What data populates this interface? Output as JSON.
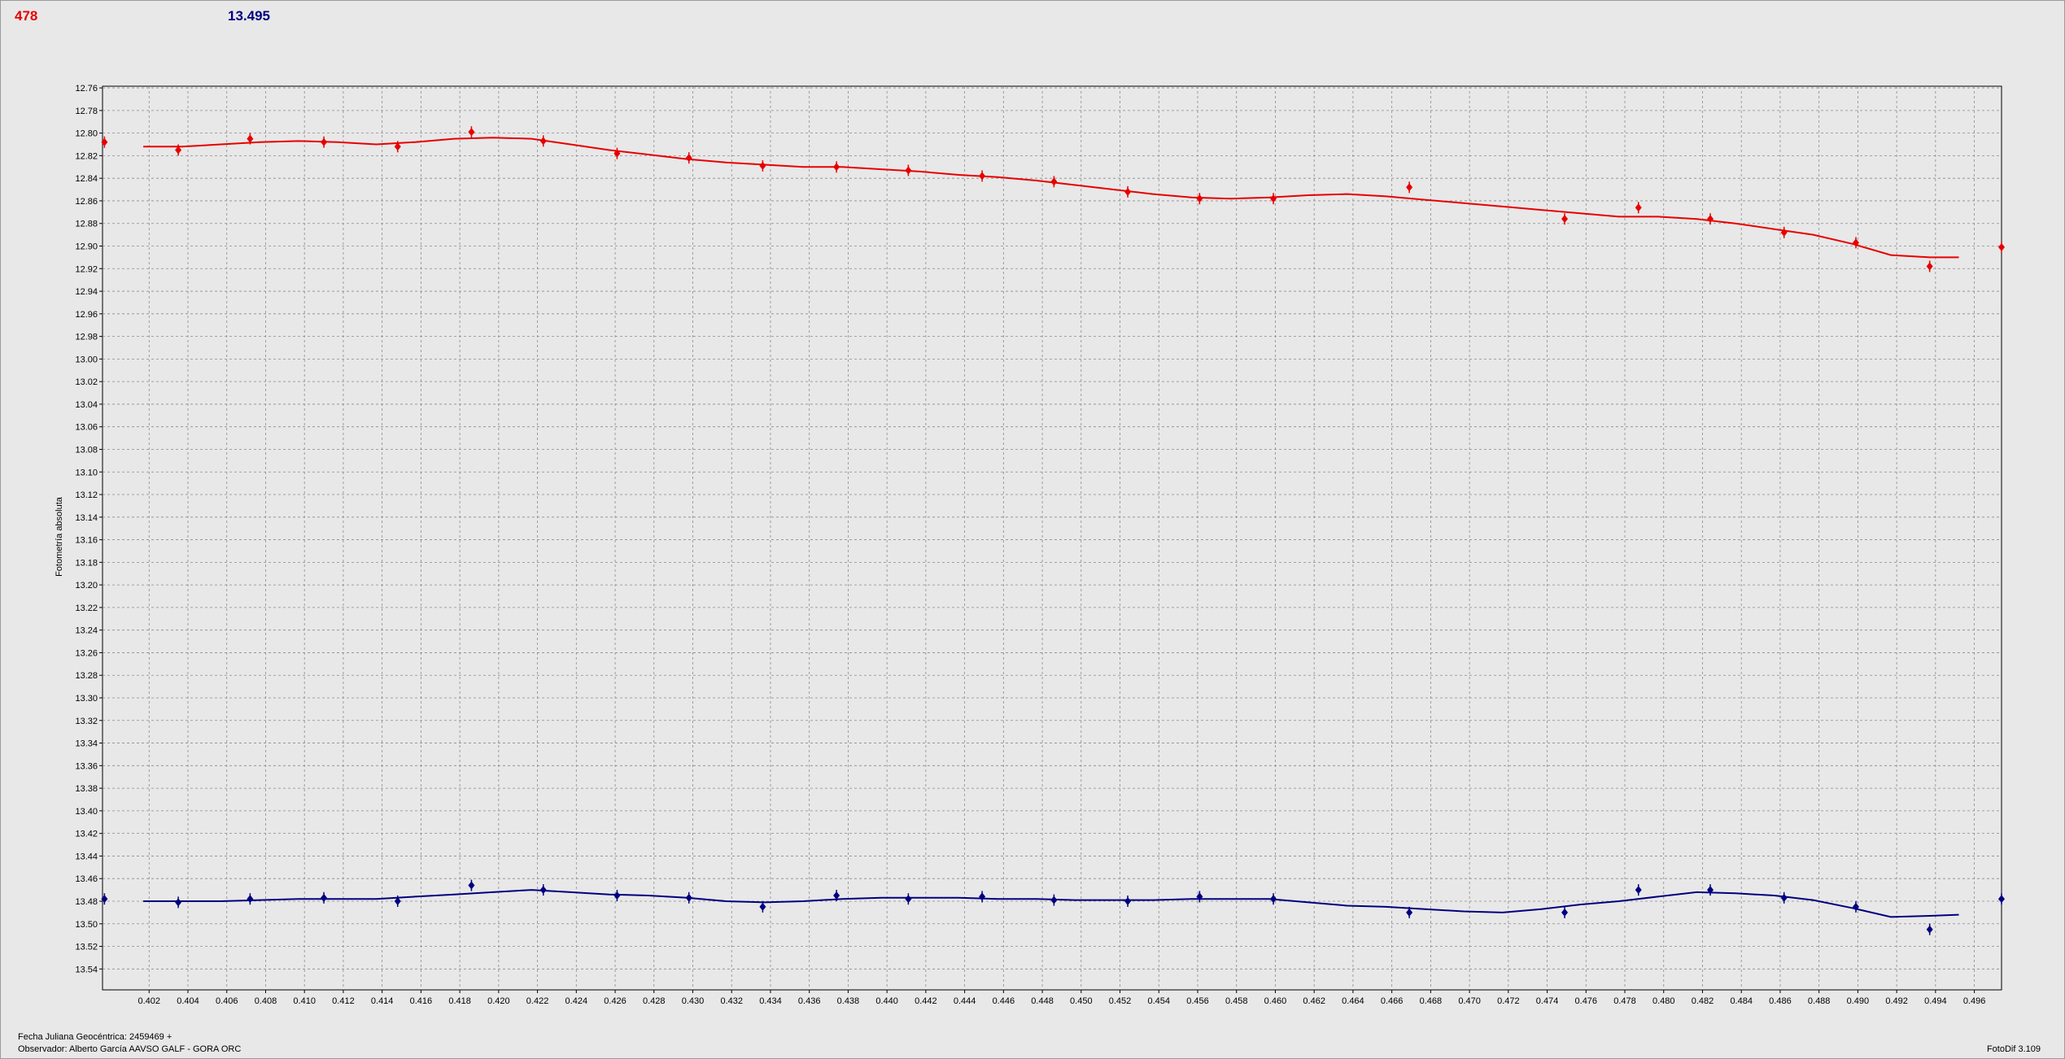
{
  "header": {
    "left_value": "478",
    "right_value": "13.495"
  },
  "footer": {
    "line1": "Fecha Juliana Geocéntrica: 2459469 +",
    "line2": "Observador: Alberto García AAVSO GALF - GORA ORC",
    "version": "FotoDif 3.109"
  },
  "colors": {
    "series_red": "#e80000",
    "series_blue": "#000080",
    "grid": "#8a8a8a",
    "plot_bg": "#e8e8e8"
  },
  "chart_data": {
    "type": "scatter",
    "title": "",
    "xlabel": "",
    "ylabel": "Fotometría absoluta",
    "xlim": [
      0.3996,
      0.4974
    ],
    "ylim": [
      12.7585,
      13.5585
    ],
    "y_inverted": true,
    "grid": true,
    "legend": "none",
    "x_ticks": [
      "0.402",
      "0.404",
      "0.406",
      "0.408",
      "0.410",
      "0.412",
      "0.414",
      "0.416",
      "0.418",
      "0.420",
      "0.422",
      "0.424",
      "0.426",
      "0.428",
      "0.430",
      "0.432",
      "0.434",
      "0.436",
      "0.438",
      "0.440",
      "0.442",
      "0.444",
      "0.446",
      "0.448",
      "0.450",
      "0.452",
      "0.454",
      "0.456",
      "0.458",
      "0.460",
      "0.462",
      "0.464",
      "0.466",
      "0.468",
      "0.470",
      "0.472",
      "0.474",
      "0.476",
      "0.478",
      "0.480",
      "0.482",
      "0.484",
      "0.486",
      "0.488",
      "0.490",
      "0.492",
      "0.494",
      "0.496"
    ],
    "y_ticks": [
      "12.76",
      "12.78",
      "12.80",
      "12.82",
      "12.84",
      "12.86",
      "12.88",
      "12.90",
      "12.92",
      "12.94",
      "12.96",
      "12.98",
      "13.00",
      "13.02",
      "13.04",
      "13.06",
      "13.08",
      "13.10",
      "13.12",
      "13.14",
      "13.16",
      "13.18",
      "13.20",
      "13.22",
      "13.24",
      "13.26",
      "13.28",
      "13.30",
      "13.32",
      "13.34",
      "13.36",
      "13.38",
      "13.40",
      "13.42",
      "13.44",
      "13.46",
      "13.48",
      "13.50",
      "13.52",
      "13.54"
    ],
    "series": [
      {
        "color": "#e80000",
        "points": [
          {
            "x": 0.3997,
            "y": 12.808
          },
          {
            "x": 0.4035,
            "y": 12.815
          },
          {
            "x": 0.4072,
            "y": 12.805
          },
          {
            "x": 0.411,
            "y": 12.808
          },
          {
            "x": 0.4148,
            "y": 12.812
          },
          {
            "x": 0.4186,
            "y": 12.799
          },
          {
            "x": 0.4223,
            "y": 12.807
          },
          {
            "x": 0.4261,
            "y": 12.818
          },
          {
            "x": 0.4298,
            "y": 12.822
          },
          {
            "x": 0.4336,
            "y": 12.829
          },
          {
            "x": 0.4374,
            "y": 12.83
          },
          {
            "x": 0.4411,
            "y": 12.833
          },
          {
            "x": 0.4449,
            "y": 12.838
          },
          {
            "x": 0.4486,
            "y": 12.843
          },
          {
            "x": 0.4524,
            "y": 12.852
          },
          {
            "x": 0.4561,
            "y": 12.858
          },
          {
            "x": 0.4599,
            "y": 12.858
          },
          {
            "x": 0.4669,
            "y": 12.848
          },
          {
            "x": 0.4749,
            "y": 12.876
          },
          {
            "x": 0.4787,
            "y": 12.866
          },
          {
            "x": 0.4824,
            "y": 12.876
          },
          {
            "x": 0.4862,
            "y": 12.888
          },
          {
            "x": 0.4899,
            "y": 12.897
          },
          {
            "x": 0.4937,
            "y": 12.918
          },
          {
            "x": 0.4974,
            "y": 12.901
          }
        ],
        "fit": [
          {
            "x": 0.4017,
            "y": 12.812
          },
          {
            "x": 0.4037,
            "y": 12.812
          },
          {
            "x": 0.4057,
            "y": 12.81
          },
          {
            "x": 0.4077,
            "y": 12.808
          },
          {
            "x": 0.4097,
            "y": 12.807
          },
          {
            "x": 0.4117,
            "y": 12.808
          },
          {
            "x": 0.4137,
            "y": 12.81
          },
          {
            "x": 0.4157,
            "y": 12.808
          },
          {
            "x": 0.4177,
            "y": 12.805
          },
          {
            "x": 0.4197,
            "y": 12.804
          },
          {
            "x": 0.4217,
            "y": 12.805
          },
          {
            "x": 0.4237,
            "y": 12.81
          },
          {
            "x": 0.4257,
            "y": 12.815
          },
          {
            "x": 0.4277,
            "y": 12.819
          },
          {
            "x": 0.4297,
            "y": 12.823
          },
          {
            "x": 0.4317,
            "y": 12.826
          },
          {
            "x": 0.4337,
            "y": 12.828
          },
          {
            "x": 0.4357,
            "y": 12.83
          },
          {
            "x": 0.4377,
            "y": 12.83
          },
          {
            "x": 0.4397,
            "y": 12.832
          },
          {
            "x": 0.4417,
            "y": 12.834
          },
          {
            "x": 0.4437,
            "y": 12.837
          },
          {
            "x": 0.4457,
            "y": 12.839
          },
          {
            "x": 0.4477,
            "y": 12.842
          },
          {
            "x": 0.4497,
            "y": 12.846
          },
          {
            "x": 0.4517,
            "y": 12.85
          },
          {
            "x": 0.4537,
            "y": 12.854
          },
          {
            "x": 0.4557,
            "y": 12.857
          },
          {
            "x": 0.4577,
            "y": 12.858
          },
          {
            "x": 0.4597,
            "y": 12.857
          },
          {
            "x": 0.4617,
            "y": 12.855
          },
          {
            "x": 0.4637,
            "y": 12.854
          },
          {
            "x": 0.4657,
            "y": 12.856
          },
          {
            "x": 0.4677,
            "y": 12.859
          },
          {
            "x": 0.4697,
            "y": 12.862
          },
          {
            "x": 0.4717,
            "y": 12.865
          },
          {
            "x": 0.4737,
            "y": 12.868
          },
          {
            "x": 0.4757,
            "y": 12.871
          },
          {
            "x": 0.4777,
            "y": 12.874
          },
          {
            "x": 0.4797,
            "y": 12.874
          },
          {
            "x": 0.4817,
            "y": 12.876
          },
          {
            "x": 0.4837,
            "y": 12.88
          },
          {
            "x": 0.4857,
            "y": 12.885
          },
          {
            "x": 0.4877,
            "y": 12.89
          },
          {
            "x": 0.4897,
            "y": 12.898
          },
          {
            "x": 0.4917,
            "y": 12.908
          },
          {
            "x": 0.4937,
            "y": 12.91
          },
          {
            "x": 0.4952,
            "y": 12.91
          }
        ]
      },
      {
        "color": "#000080",
        "points": [
          {
            "x": 0.3997,
            "y": 13.478
          },
          {
            "x": 0.4035,
            "y": 13.481
          },
          {
            "x": 0.4072,
            "y": 13.478
          },
          {
            "x": 0.411,
            "y": 13.477
          },
          {
            "x": 0.4148,
            "y": 13.48
          },
          {
            "x": 0.4186,
            "y": 13.466
          },
          {
            "x": 0.4223,
            "y": 13.47
          },
          {
            "x": 0.4261,
            "y": 13.475
          },
          {
            "x": 0.4298,
            "y": 13.477
          },
          {
            "x": 0.4336,
            "y": 13.485
          },
          {
            "x": 0.4374,
            "y": 13.475
          },
          {
            "x": 0.4411,
            "y": 13.478
          },
          {
            "x": 0.4449,
            "y": 13.476
          },
          {
            "x": 0.4486,
            "y": 13.479
          },
          {
            "x": 0.4524,
            "y": 13.48
          },
          {
            "x": 0.4561,
            "y": 13.476
          },
          {
            "x": 0.4599,
            "y": 13.478
          },
          {
            "x": 0.4669,
            "y": 13.49
          },
          {
            "x": 0.4749,
            "y": 13.49
          },
          {
            "x": 0.4787,
            "y": 13.47
          },
          {
            "x": 0.4824,
            "y": 13.47
          },
          {
            "x": 0.4862,
            "y": 13.477
          },
          {
            "x": 0.4899,
            "y": 13.485
          },
          {
            "x": 0.4937,
            "y": 13.505
          },
          {
            "x": 0.4974,
            "y": 13.478
          }
        ],
        "fit": [
          {
            "x": 0.4017,
            "y": 13.48
          },
          {
            "x": 0.4037,
            "y": 13.48
          },
          {
            "x": 0.4057,
            "y": 13.48
          },
          {
            "x": 0.4077,
            "y": 13.479
          },
          {
            "x": 0.4097,
            "y": 13.478
          },
          {
            "x": 0.4117,
            "y": 13.478
          },
          {
            "x": 0.4137,
            "y": 13.478
          },
          {
            "x": 0.4157,
            "y": 13.476
          },
          {
            "x": 0.4177,
            "y": 13.474
          },
          {
            "x": 0.4197,
            "y": 13.472
          },
          {
            "x": 0.4217,
            "y": 13.47
          },
          {
            "x": 0.4237,
            "y": 13.472
          },
          {
            "x": 0.4257,
            "y": 13.474
          },
          {
            "x": 0.4277,
            "y": 13.475
          },
          {
            "x": 0.4297,
            "y": 13.477
          },
          {
            "x": 0.4317,
            "y": 13.48
          },
          {
            "x": 0.4337,
            "y": 13.481
          },
          {
            "x": 0.4357,
            "y": 13.48
          },
          {
            "x": 0.4377,
            "y": 13.478
          },
          {
            "x": 0.4397,
            "y": 13.477
          },
          {
            "x": 0.4417,
            "y": 13.477
          },
          {
            "x": 0.4437,
            "y": 13.477
          },
          {
            "x": 0.4457,
            "y": 13.478
          },
          {
            "x": 0.4477,
            "y": 13.478
          },
          {
            "x": 0.4497,
            "y": 13.479
          },
          {
            "x": 0.4517,
            "y": 13.479
          },
          {
            "x": 0.4537,
            "y": 13.479
          },
          {
            "x": 0.4557,
            "y": 13.478
          },
          {
            "x": 0.4577,
            "y": 13.478
          },
          {
            "x": 0.4597,
            "y": 13.478
          },
          {
            "x": 0.4617,
            "y": 13.481
          },
          {
            "x": 0.4637,
            "y": 13.484
          },
          {
            "x": 0.4657,
            "y": 13.485
          },
          {
            "x": 0.4677,
            "y": 13.487
          },
          {
            "x": 0.4697,
            "y": 13.489
          },
          {
            "x": 0.4717,
            "y": 13.49
          },
          {
            "x": 0.4737,
            "y": 13.487
          },
          {
            "x": 0.4757,
            "y": 13.483
          },
          {
            "x": 0.4777,
            "y": 13.48
          },
          {
            "x": 0.4797,
            "y": 13.476
          },
          {
            "x": 0.4817,
            "y": 13.472
          },
          {
            "x": 0.4837,
            "y": 13.473
          },
          {
            "x": 0.4857,
            "y": 13.475
          },
          {
            "x": 0.4877,
            "y": 13.479
          },
          {
            "x": 0.4897,
            "y": 13.486
          },
          {
            "x": 0.4917,
            "y": 13.494
          },
          {
            "x": 0.4937,
            "y": 13.493
          },
          {
            "x": 0.4952,
            "y": 13.492
          }
        ]
      }
    ]
  }
}
